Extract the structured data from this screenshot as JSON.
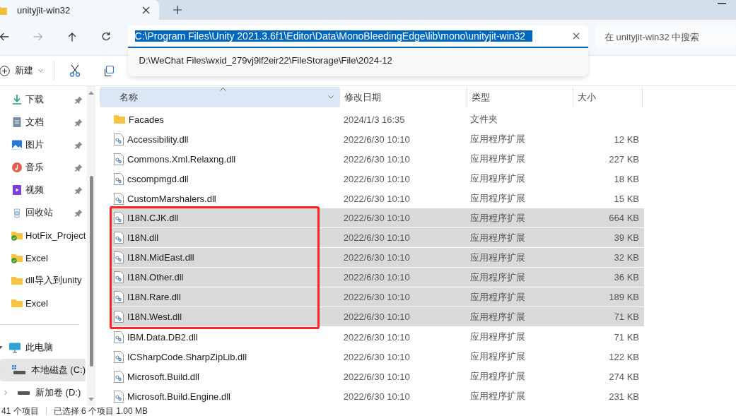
{
  "tab": {
    "title": "unityjit-win32",
    "selected": true
  },
  "nav_buttons": [
    {
      "kind": "back",
      "disabled": false
    },
    {
      "kind": "forward",
      "disabled": true
    },
    {
      "kind": "up",
      "disabled": false
    },
    {
      "kind": "refresh",
      "disabled": false
    }
  ],
  "address": {
    "value": "C:\\Program Files\\Unity 2021.3.6f1\\Editor\\Data\\MonoBleedingEdge\\lib\\mono\\unityjit-win32",
    "selected": true
  },
  "address_suggestions": [
    "D:\\WeChat Files\\wxid_279vj9lf2eir22\\FileStorage\\File\\2024-12"
  ],
  "search": {
    "placeholder": "在 unityjit-win32 中搜索"
  },
  "toolbar": {
    "new_label": "新建"
  },
  "sidebar": {
    "quick_access": [
      {
        "label": "下载",
        "kind": "download",
        "pinned": true,
        "synced": false
      },
      {
        "label": "文档",
        "kind": "document",
        "pinned": true,
        "synced": false
      },
      {
        "label": "图片",
        "kind": "pictures",
        "pinned": true,
        "synced": false
      },
      {
        "label": "音乐",
        "kind": "music",
        "pinned": true,
        "synced": false
      },
      {
        "label": "视频",
        "kind": "video",
        "pinned": true,
        "synced": false
      },
      {
        "label": "回收站",
        "kind": "recycle",
        "pinned": true,
        "synced": false
      },
      {
        "label": "HotFix_Project",
        "kind": "folder",
        "pinned": false,
        "synced": true
      },
      {
        "label": "Excel",
        "kind": "folder",
        "pinned": false,
        "synced": true
      },
      {
        "label": "dll导入到unity",
        "kind": "folder",
        "pinned": false,
        "synced": false
      },
      {
        "label": "Excel",
        "kind": "folder",
        "pinned": false,
        "synced": false
      }
    ],
    "tree": [
      {
        "label": "此电脑",
        "kind": "computer",
        "expanded": true,
        "selected": false,
        "children": [
          {
            "label": "本地磁盘 (C:)",
            "kind": "system-drive",
            "expanded": false,
            "selected": true
          },
          {
            "label": "新加卷 (D:)",
            "kind": "drive",
            "expanded": false,
            "selected": false
          }
        ]
      }
    ]
  },
  "table": {
    "columns": [
      {
        "label": "名称",
        "sorted": true,
        "hovered": true
      },
      {
        "label": "修改日期",
        "sorted": false,
        "hovered": false
      },
      {
        "label": "类型",
        "sorted": false,
        "hovered": false
      },
      {
        "label": "大小",
        "sorted": false,
        "hovered": false
      }
    ],
    "row_groups": [
      {
        "marked": false,
        "rows": [
          {
            "kind": "folder",
            "name": "Facades",
            "date": "2024/1/3 16:35",
            "type": "文件夹",
            "size": "",
            "selected": false
          },
          {
            "kind": "file",
            "name": "Accessibility.dll",
            "date": "2022/6/30 10:10",
            "type": "应用程序扩展",
            "size": "12 KB",
            "selected": false
          },
          {
            "kind": "file",
            "name": "Commons.Xml.Relaxng.dll",
            "date": "2022/6/30 10:10",
            "type": "应用程序扩展",
            "size": "227 KB",
            "selected": false
          },
          {
            "kind": "file",
            "name": "cscompmgd.dll",
            "date": "2022/6/30 10:10",
            "type": "应用程序扩展",
            "size": "18 KB",
            "selected": false
          },
          {
            "kind": "file",
            "name": "CustomMarshalers.dll",
            "date": "2022/6/30 10:10",
            "type": "应用程序扩展",
            "size": "15 KB",
            "selected": false
          }
        ]
      },
      {
        "marked": true,
        "rows": [
          {
            "kind": "file",
            "name": "I18N.CJK.dll",
            "date": "2022/6/30 10:10",
            "type": "应用程序扩展",
            "size": "664 KB",
            "selected": true
          },
          {
            "kind": "file",
            "name": "I18N.dll",
            "date": "2022/6/30 10:10",
            "type": "应用程序扩展",
            "size": "39 KB",
            "selected": true
          },
          {
            "kind": "file",
            "name": "I18N.MidEast.dll",
            "date": "2022/6/30 10:10",
            "type": "应用程序扩展",
            "size": "32 KB",
            "selected": true
          },
          {
            "kind": "file",
            "name": "I18N.Other.dll",
            "date": "2022/6/30 10:10",
            "type": "应用程序扩展",
            "size": "36 KB",
            "selected": true
          },
          {
            "kind": "file",
            "name": "I18N.Rare.dll",
            "date": "2022/6/30 10:10",
            "type": "应用程序扩展",
            "size": "189 KB",
            "selected": true
          },
          {
            "kind": "file",
            "name": "I18N.West.dll",
            "date": "2022/6/30 10:10",
            "type": "应用程序扩展",
            "size": "71 KB",
            "selected": true
          }
        ]
      },
      {
        "marked": false,
        "rows": [
          {
            "kind": "file",
            "name": "IBM.Data.DB2.dll",
            "date": "2022/6/30 10:10",
            "type": "应用程序扩展",
            "size": "71 KB",
            "selected": false
          },
          {
            "kind": "file",
            "name": "ICSharpCode.SharpZipLib.dll",
            "date": "2022/6/30 10:10",
            "type": "应用程序扩展",
            "size": "122 KB",
            "selected": false
          },
          {
            "kind": "file",
            "name": "Microsoft.Build.dll",
            "date": "2022/6/30 10:10",
            "type": "应用程序扩展",
            "size": "274 KB",
            "selected": false
          },
          {
            "kind": "file",
            "name": "Microsoft.Build.Engine.dll",
            "date": "2022/6/30 10:10",
            "type": "应用程序扩展",
            "size": "231 KB",
            "selected": false
          }
        ]
      }
    ]
  },
  "status_bar": {
    "item_count": "41 个项目",
    "selection": "已选择 6 个项目  1.00 MB"
  }
}
